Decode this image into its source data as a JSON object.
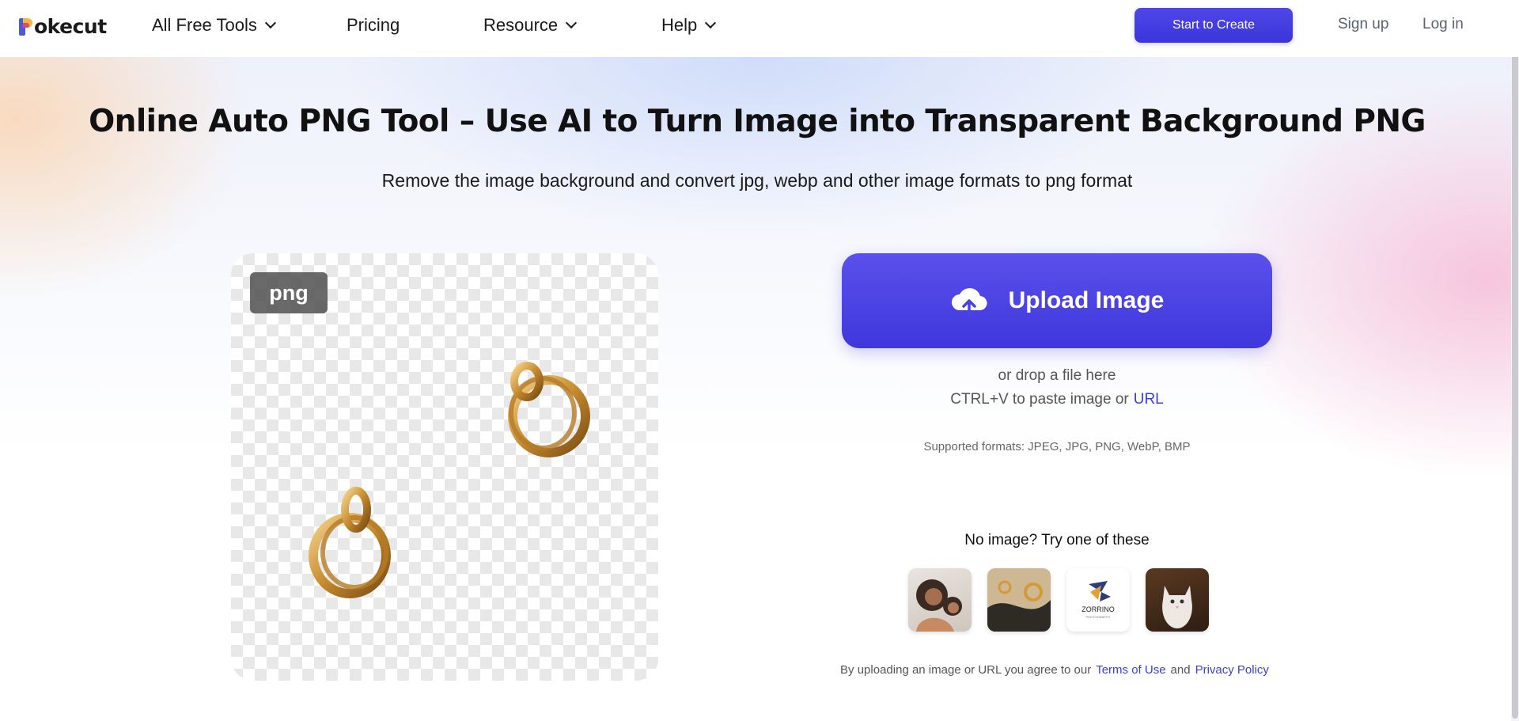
{
  "header": {
    "logo_text": "Pokecut",
    "nav": [
      {
        "label": "All Free Tools",
        "dropdown": true
      },
      {
        "label": "Pricing",
        "dropdown": false
      },
      {
        "label": "Resource",
        "dropdown": true
      },
      {
        "label": "Help",
        "dropdown": true
      }
    ],
    "start_button": "Start to Create",
    "sign_up": "Sign up",
    "log_in": "Log in"
  },
  "hero": {
    "title": "Online Auto PNG Tool – Use AI to Turn Image into Transparent Background PNG",
    "subtitle": "Remove the image background and convert jpg, webp and other image formats to png format"
  },
  "preview": {
    "badge": "png"
  },
  "upload": {
    "button_label": "Upload Image",
    "drop_text": "or drop a file here",
    "paste_text": "CTRL+V to paste image or",
    "url_link": "URL",
    "formats": "Supported formats: JPEG, JPG, PNG, WebP, BMP"
  },
  "samples": {
    "heading": "No image? Try one of these",
    "items": [
      {
        "name": "sample-woman",
        "icon": "portrait"
      },
      {
        "name": "sample-jewelry",
        "icon": "earring"
      },
      {
        "name": "sample-logo",
        "icon": "logo",
        "text": "ZORRINO",
        "subtext": "PHOTOGRAPHY"
      },
      {
        "name": "sample-cat",
        "icon": "cat"
      }
    ]
  },
  "terms": {
    "prefix": "By uploading an image or URL you agree to our",
    "terms_link": "Terms of Use",
    "and": "and",
    "privacy_link": "Privacy Policy"
  },
  "colors": {
    "accent": "#4f46e5",
    "link": "#3b3fd4"
  }
}
